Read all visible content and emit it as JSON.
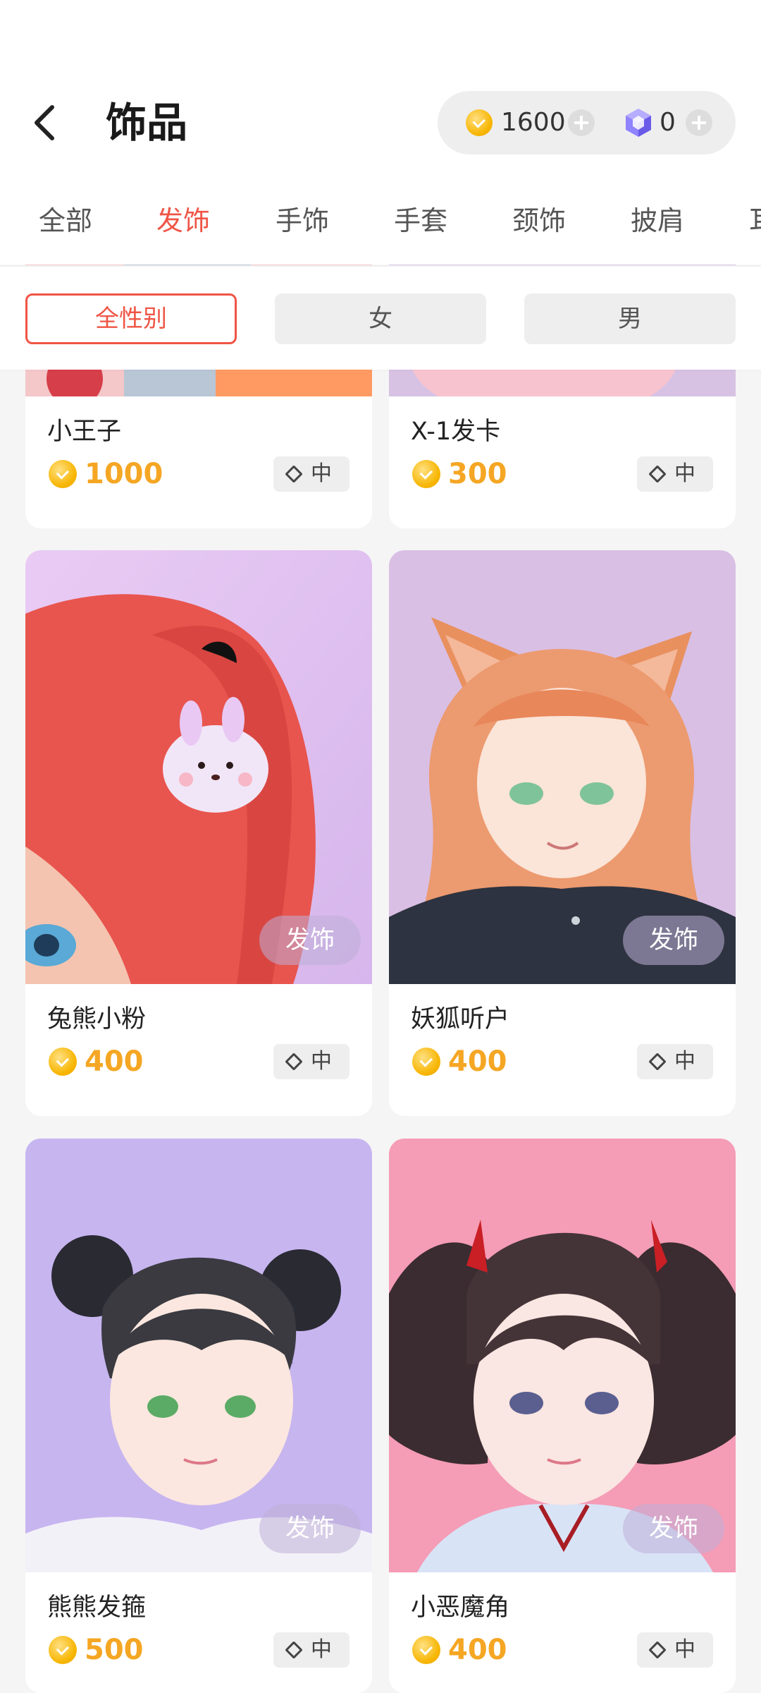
{
  "header": {
    "title": "饰品",
    "coins": "1600",
    "gems": "0"
  },
  "tabs": [
    "全部",
    "发饰",
    "手饰",
    "手套",
    "颈饰",
    "披肩",
    "耳"
  ],
  "active_tab": 1,
  "gender_filter": {
    "options": [
      "全性别",
      "女",
      "男"
    ],
    "active": 0
  },
  "items": [
    {
      "name": "小王子",
      "price": "1000",
      "tier": "中"
    },
    {
      "name": "X-1发卡",
      "price": "300",
      "tier": "中"
    },
    {
      "name": "兔熊小粉",
      "price": "400",
      "tier": "中",
      "category": "发饰"
    },
    {
      "name": "妖狐听户",
      "price": "400",
      "tier": "中",
      "category": "发饰"
    },
    {
      "name": "熊熊发箍",
      "price": "500",
      "tier": "中",
      "category": "发饰"
    },
    {
      "name": "小恶魔角",
      "price": "400",
      "tier": "中",
      "category": "发饰"
    }
  ],
  "colors": {
    "accent": "#ef5546",
    "price": "#f5a623",
    "coin": "#f7b500",
    "gem": "#7a6cf0"
  }
}
